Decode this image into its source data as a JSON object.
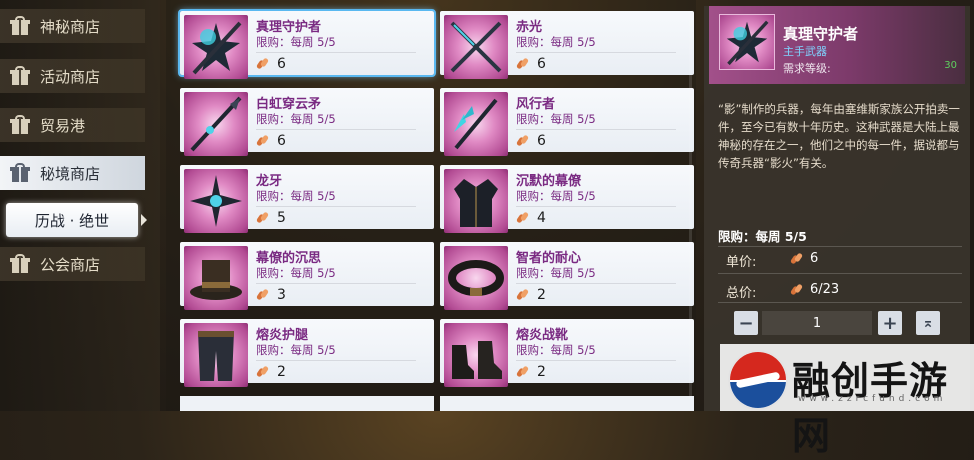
{
  "sidebar": {
    "items": [
      {
        "label": "神秘商店",
        "active": false
      },
      {
        "label": "活动商店",
        "active": false
      },
      {
        "label": "贸易港",
        "active": false
      },
      {
        "label": "秘境商店",
        "active": true
      },
      {
        "label": "公会商店",
        "active": false
      }
    ],
    "sub_item": "历战 · 绝世"
  },
  "items": [
    {
      "name": "真理守护者",
      "limit": "限购：每周 5/5",
      "price": "6",
      "icon": "dark-star-weapon-icon"
    },
    {
      "name": "赤光",
      "limit": "限购：每周 5/5",
      "price": "6",
      "icon": "crossed-swords-icon"
    },
    {
      "name": "白虹穿云矛",
      "limit": "限购：每周 5/5",
      "price": "6",
      "icon": "spear-icon"
    },
    {
      "name": "风行者",
      "limit": "限购：每周 5/5",
      "price": "6",
      "icon": "blade-staff-icon"
    },
    {
      "name": "龙牙",
      "limit": "限购：每周 5/5",
      "price": "5",
      "icon": "spiked-star-icon"
    },
    {
      "name": "沉默的幕僚",
      "limit": "限购：每周 5/5",
      "price": "4",
      "icon": "coat-icon"
    },
    {
      "name": "幕僚的沉思",
      "limit": "限购：每周 5/5",
      "price": "3",
      "icon": "top-hat-icon"
    },
    {
      "name": "智者的耐心",
      "limit": "限购：每周 5/5",
      "price": "2",
      "icon": "belt-icon"
    },
    {
      "name": "熔炎护腿",
      "limit": "限购：每周 5/5",
      "price": "2",
      "icon": "leggings-icon"
    },
    {
      "name": "熔炎战靴",
      "limit": "限购：每周 5/5",
      "price": "2",
      "icon": "boots-icon"
    }
  ],
  "detail": {
    "title": "真理守护者",
    "type": "主手武器",
    "requirement": "需求等级:",
    "level": "30",
    "description": "“影”制作的兵器，每年由塞维斯家族公开拍卖一件，至今已有数十年历史。这种武器是大陆上最神秘的存在之一，他们之中的每一件，据说都与传奇兵器“影火”有关。",
    "limit": "限购：每周 5/5",
    "unit_price_label": "单价:",
    "unit_price": "6",
    "total_price_label": "总价:",
    "total_price": "6/23",
    "quantity": "1",
    "minus": "−",
    "plus": "+",
    "max": "⌅"
  },
  "watermark": {
    "text": "融创手游网",
    "url": "www.zzrcfund.com"
  },
  "colors": {
    "accent_pink": "#e08ac4",
    "name_purple": "#7a2a82",
    "selected_blue": "#5ab8f0"
  }
}
